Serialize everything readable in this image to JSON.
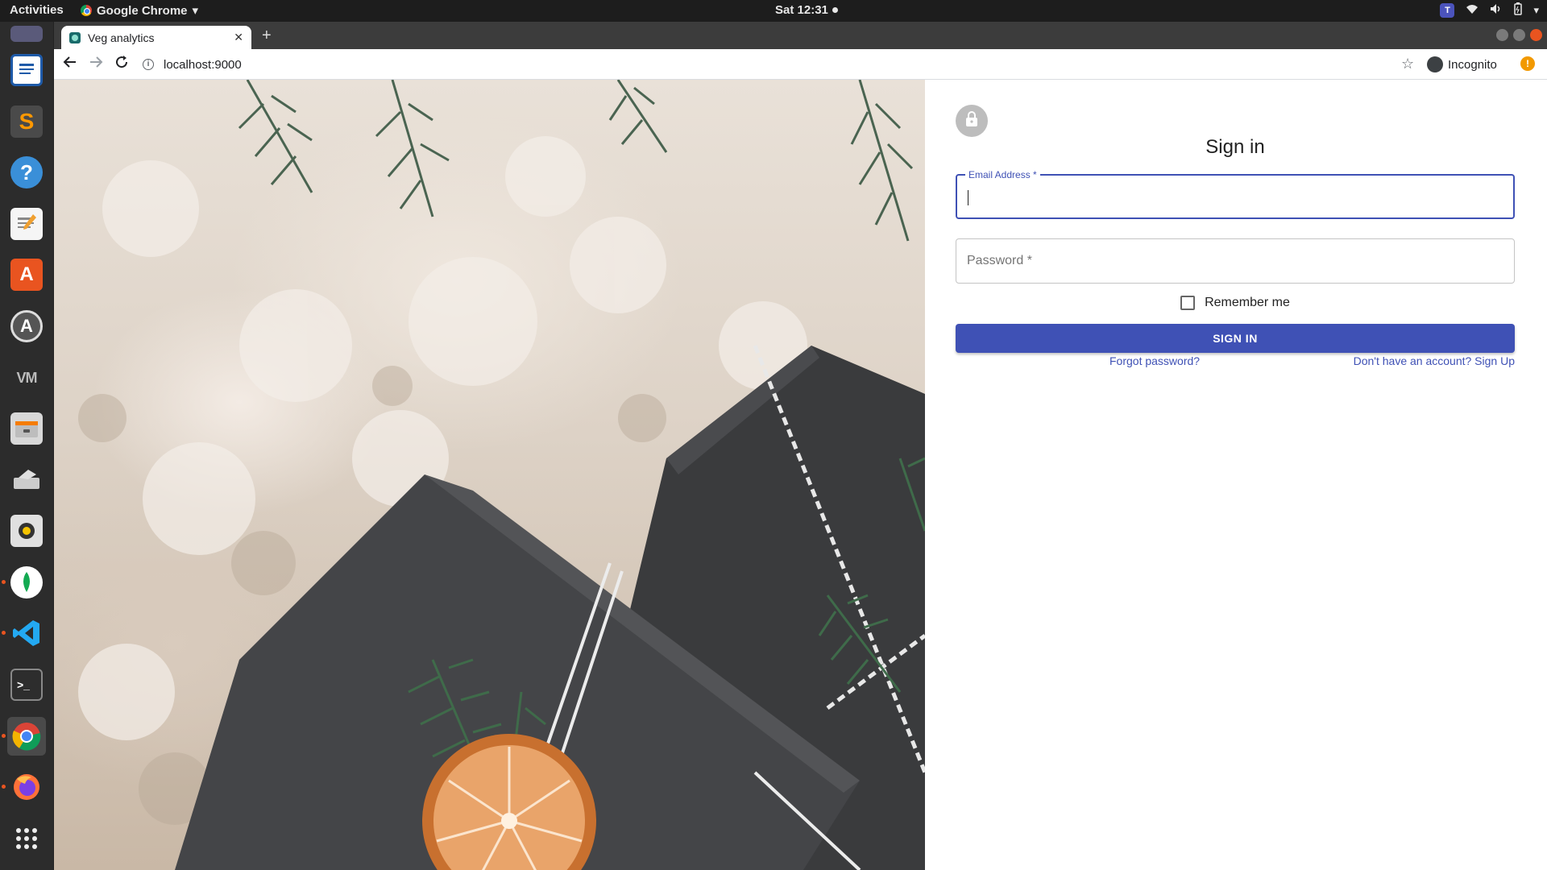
{
  "system": {
    "activities": "Activities",
    "app_name": "Google Chrome",
    "clock": "Sat 12:31"
  },
  "dock": {
    "apps": [
      "Text Editor",
      "Sublime Text",
      "Help",
      "Notes",
      "Software",
      "Software Updater",
      "VM",
      "Files",
      "Scanner",
      "Rhythmbox",
      "MongoDB Compass",
      "Visual Studio Code",
      "Terminal",
      "Google Chrome",
      "Firefox",
      "Show Applications"
    ],
    "active_app": "Google Chrome"
  },
  "browser": {
    "tab_title": "Veg analytics",
    "url": "localhost:9000",
    "incognito_label": "Incognito"
  },
  "signin": {
    "heading": "Sign in",
    "email_label": "Email Address *",
    "email_value": "",
    "password_placeholder": "Password *",
    "remember_label": "Remember me",
    "remember_checked": false,
    "submit_label": "SIGN IN",
    "forgot_link": "Forgot password?",
    "signup_link": "Don't have an account? Sign Up"
  },
  "colors": {
    "primary": "#3f51b5",
    "ubuntu_orange": "#e95420"
  }
}
